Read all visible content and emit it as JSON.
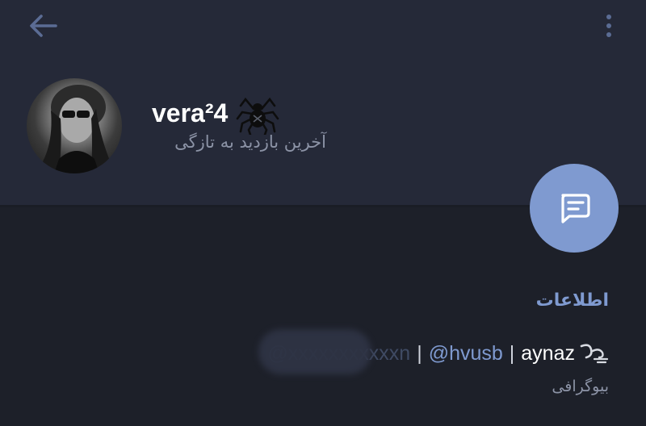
{
  "header": {
    "name": "vera²4",
    "status": "آخرین بازدید به تازگی"
  },
  "info": {
    "section_title": "اطلاعات",
    "bio_parts": {
      "hidden_link": "@xxxxxxxxxxxn",
      "separator": "|",
      "link": "@hvusb",
      "name": "aynaz"
    },
    "bio_label": "بیوگرافی"
  },
  "colors": {
    "accent": "#7f9ad0",
    "header_bg": "#252938",
    "body_bg": "#1d2029"
  },
  "icons": {
    "back": "arrow-left-icon",
    "menu": "more-vertical-icon",
    "spider": "spider-emoji-icon",
    "message": "message-icon",
    "wind": "wind-emoji-icon"
  }
}
